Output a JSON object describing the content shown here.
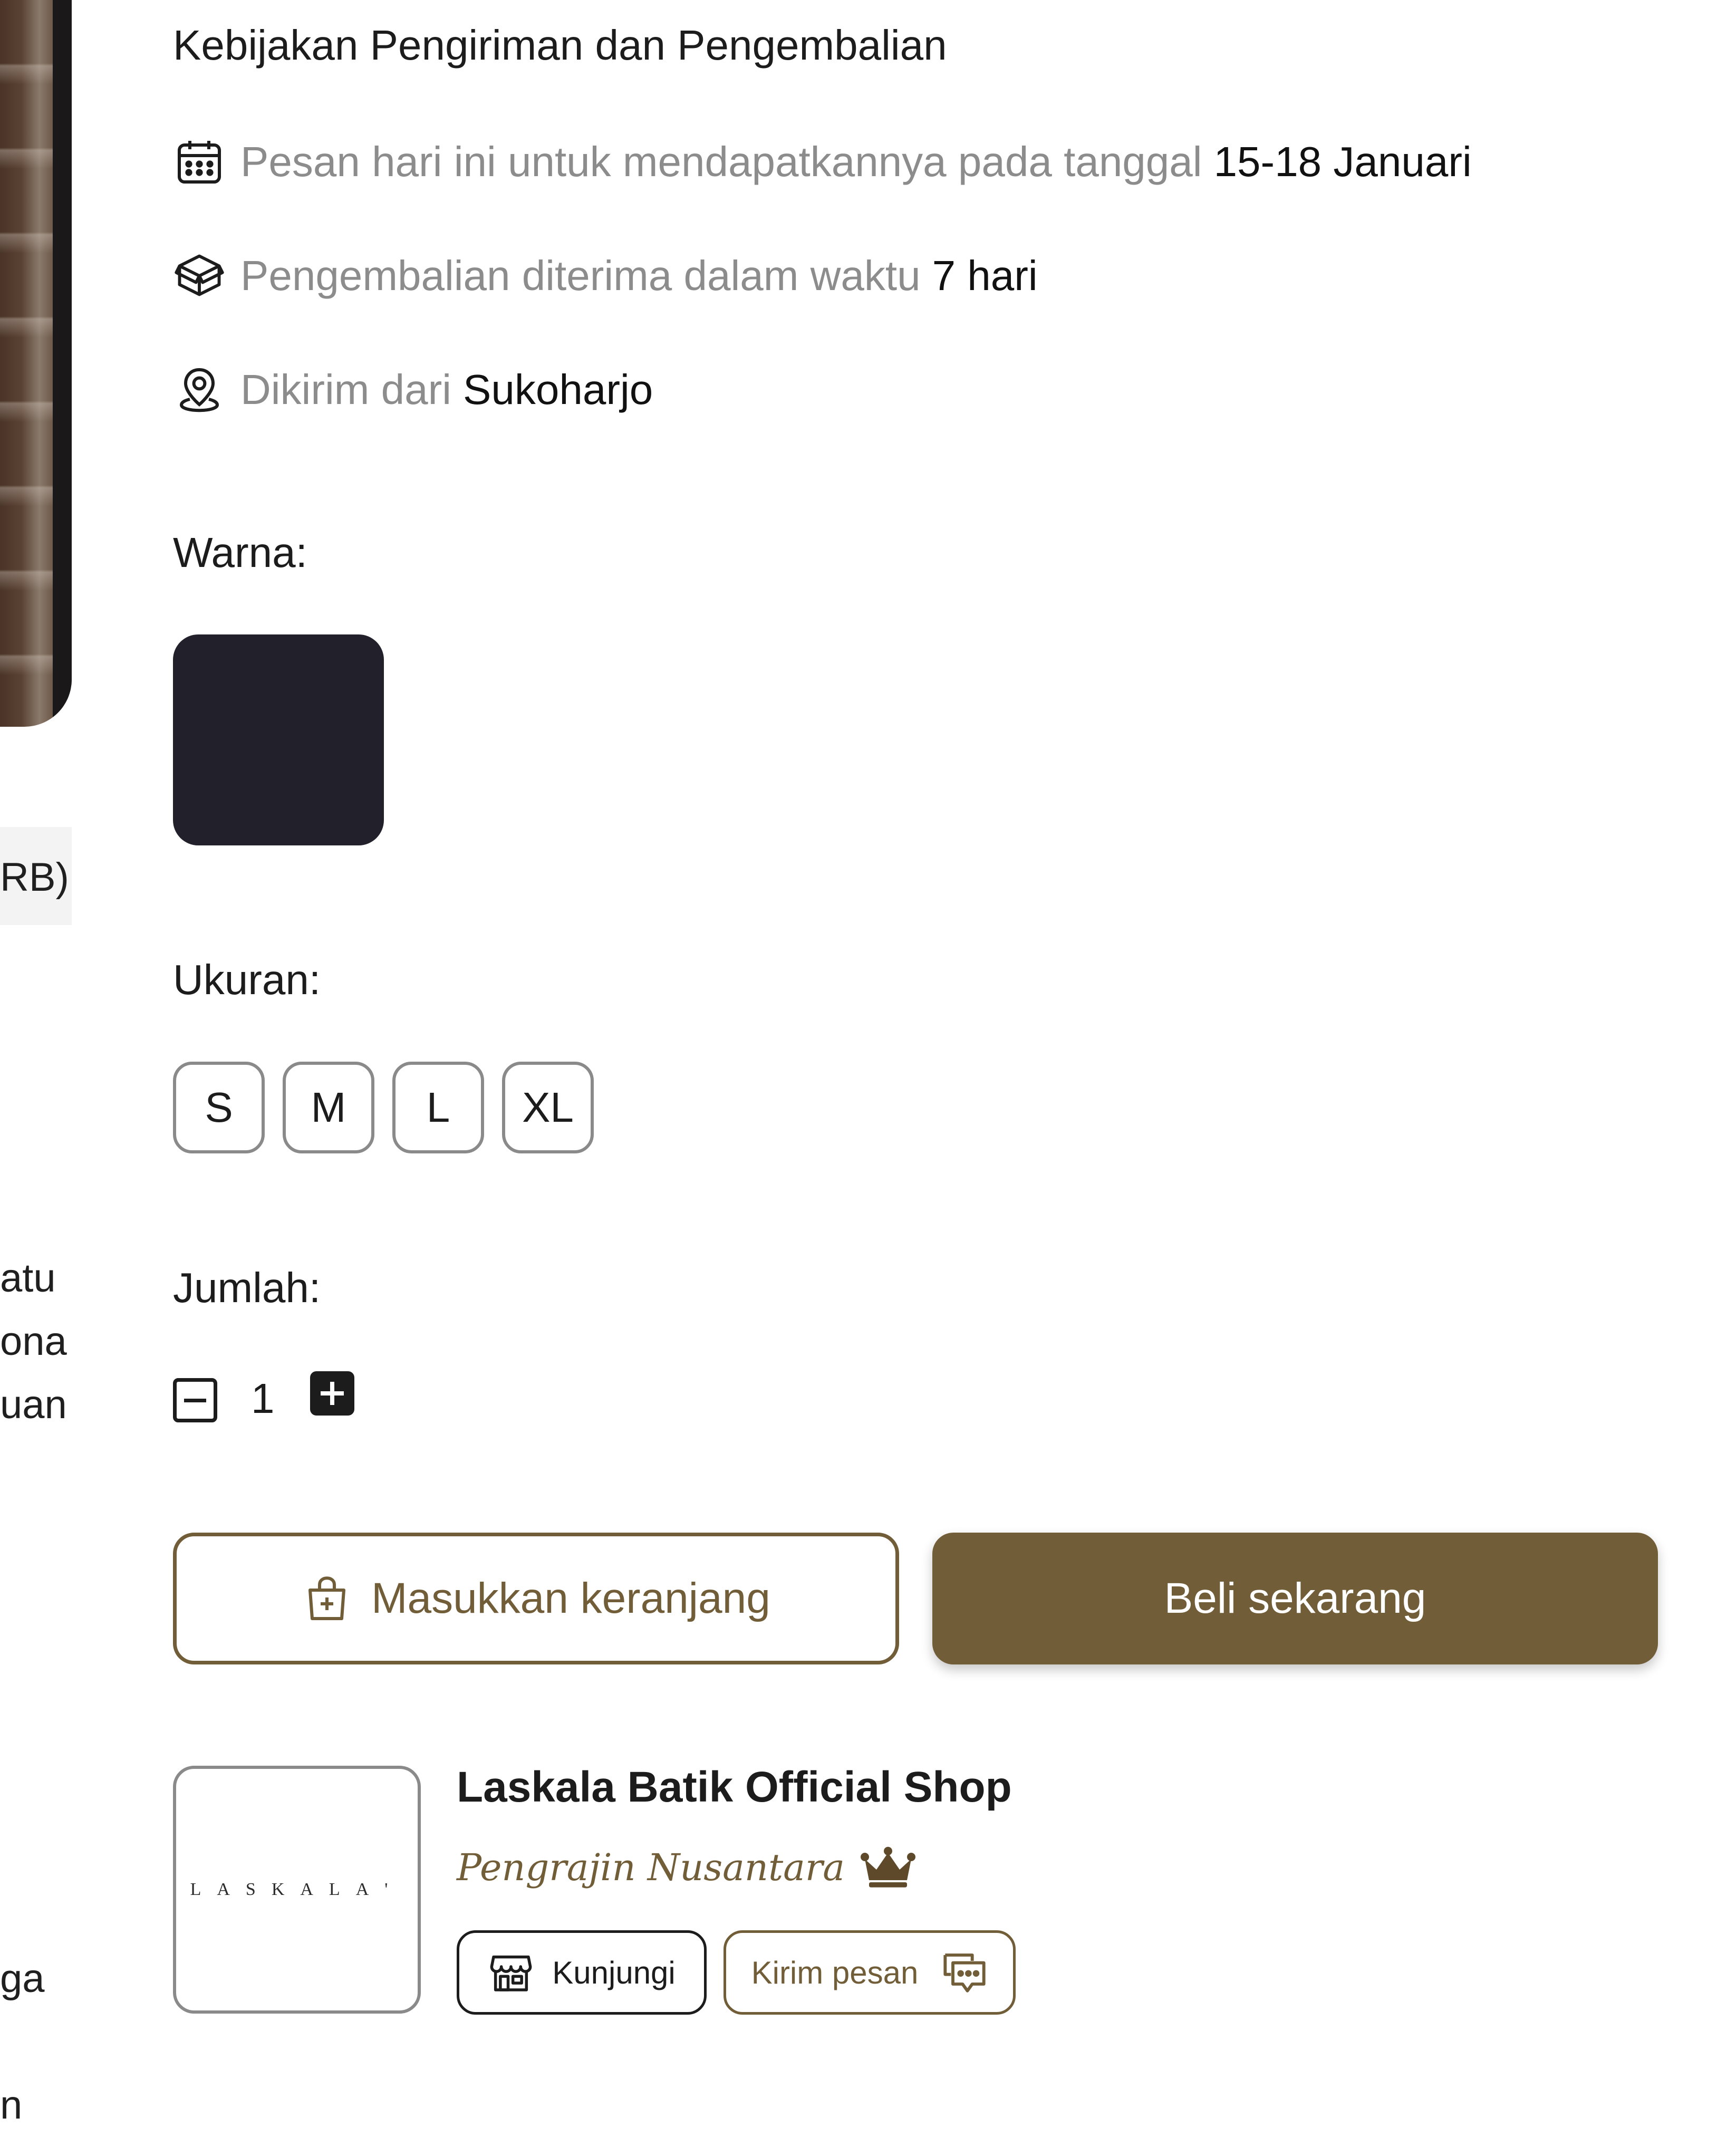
{
  "shipping": {
    "title": "Kebijakan Pengiriman dan Pengembalian",
    "delivery_text": "Pesan hari ini untuk mendapatkannya pada tanggal",
    "delivery_date": "15-18 Januari",
    "return_text": "Pengembalian diterima dalam waktu",
    "return_period": "7 hari",
    "origin_text": "Dikirim dari",
    "origin_city": "Sukoharjo",
    "icons": [
      "calendar-icon",
      "box-icon",
      "location-pin-icon"
    ]
  },
  "left_fragments": {
    "rating_fragment": "RB)",
    "lines": [
      "atu",
      "ona",
      "uan",
      "ga",
      "n"
    ]
  },
  "color_selector": {
    "label": "Warna:",
    "selected_color": "#22212b"
  },
  "size_selector": {
    "label": "Ukuran:",
    "options": [
      "S",
      "M",
      "L",
      "XL"
    ]
  },
  "quantity": {
    "label": "Jumlah:",
    "value": "1",
    "icons": [
      "minus-square-icon",
      "plus-square-icon"
    ]
  },
  "actions": {
    "add_to_cart_label": "Masukkan keranjang",
    "buy_now_label": "Beli sekarang",
    "accent_color": "#715d37"
  },
  "shop": {
    "logo_text": "LASKALA'",
    "name": "Laskala Batik Official Shop",
    "tier": "Pengrajin Nusantara",
    "visit_label": "Kunjungi",
    "message_label": "Kirim pesan"
  }
}
